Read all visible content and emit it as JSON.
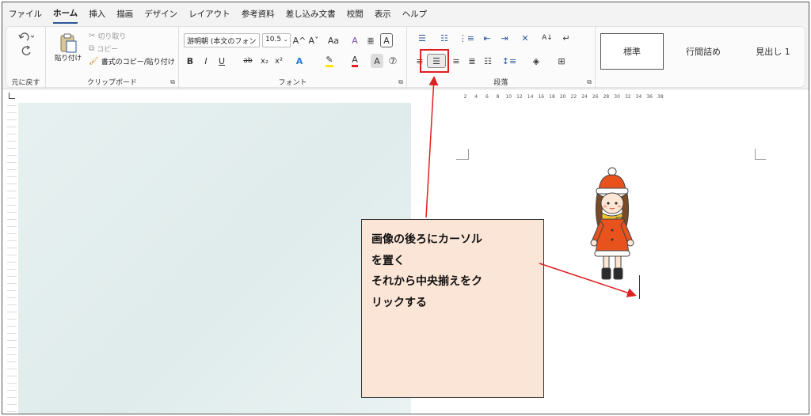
{
  "menu": {
    "tabs": [
      "ファイル",
      "ホーム",
      "挿入",
      "描画",
      "デザイン",
      "レイアウト",
      "参考資料",
      "差し込み文書",
      "校閲",
      "表示",
      "ヘルプ"
    ],
    "active_tab": "ホーム"
  },
  "ribbon": {
    "undo": {
      "group_label": "元に戻す"
    },
    "clipboard": {
      "paste_label": "貼り付け",
      "cut_label": "切り取り",
      "copy_label": "コピー",
      "format_painter_label": "書式のコピー/貼り付け",
      "group_label": "クリップボード"
    },
    "font": {
      "font_name": "游明朝 (本文のフォン",
      "font_size": "10.5",
      "bold": "B",
      "italic": "I",
      "underline": "U",
      "strike": "ab",
      "subscript": "x₂",
      "superscript": "x²",
      "grow": "A^",
      "shrink": "Aˇ",
      "case": "Aa",
      "group_label": "フォント"
    },
    "paragraph": {
      "group_label": "段落"
    },
    "styles": [
      "標準",
      "行間詰め",
      "見出し 1"
    ]
  },
  "ruler": {
    "ticks": [
      "2",
      "4",
      "6",
      "8",
      "10",
      "12",
      "14",
      "16",
      "18",
      "20",
      "22",
      "24",
      "26",
      "28",
      "30",
      "32",
      "34",
      "36",
      "38"
    ]
  },
  "callout": {
    "lines": [
      "画像の後ろにカーソル",
      "を置く",
      "それから中央揃えをク",
      "リックする"
    ]
  },
  "colors": {
    "highlight": "#e02020",
    "callout_bg": "#fbe5d6",
    "canvas_bg": "#e3eeee",
    "accent": "#2b579a"
  }
}
